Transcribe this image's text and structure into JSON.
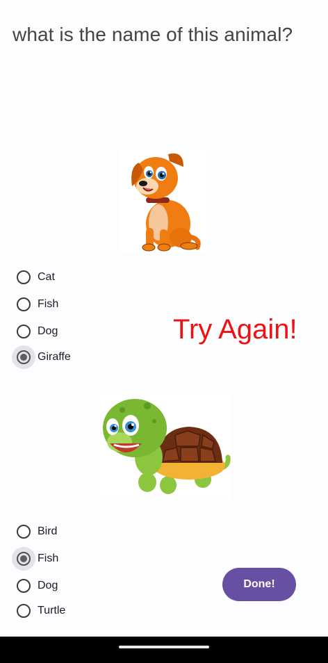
{
  "question": {
    "text": "what is the name of this animal?"
  },
  "quiz1": {
    "image_icon": "cartoon-dog",
    "options": [
      "Cat",
      "Fish",
      "Dog",
      "Giraffe"
    ],
    "selected": "Giraffe"
  },
  "feedback": {
    "text": "Try Again!",
    "color": "#ee1111"
  },
  "quiz2": {
    "image_icon": "cartoon-turtle",
    "options": [
      "Bird",
      "Fish",
      "Dog",
      "Turtle"
    ],
    "selected": "Fish"
  },
  "done_button": {
    "label": "Done!",
    "color": "#6750a4"
  }
}
